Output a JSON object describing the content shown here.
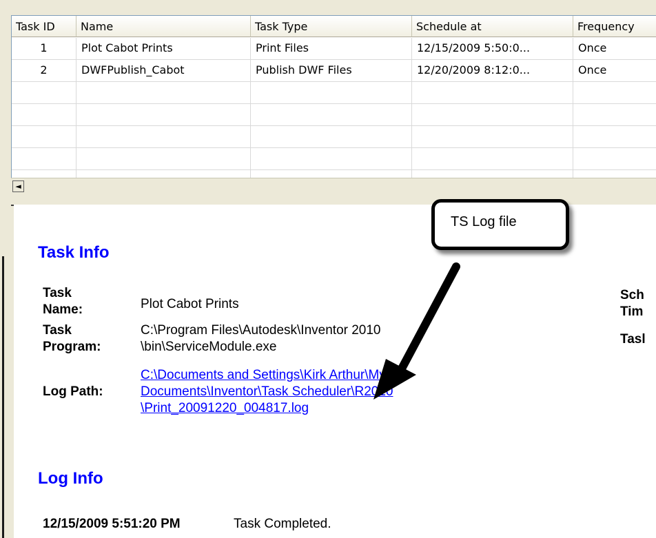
{
  "grid": {
    "columns": [
      "Task ID",
      "Name",
      "Task Type",
      "Schedule at",
      "Frequency"
    ],
    "rows": [
      [
        "1",
        "Plot Cabot Prints",
        "Print Files",
        "12/15/2009 5:50:0...",
        "Once"
      ],
      [
        "2",
        "DWFPublish_Cabot",
        "Publish DWF Files",
        "12/20/2009 8:12:0...",
        "Once"
      ]
    ],
    "scroll_left": "◄"
  },
  "callout": {
    "text": "TS Log file"
  },
  "task_info": {
    "title": "Task Info",
    "task_name_label_1": "Task",
    "task_name_label_2": "Name:",
    "task_name_value": "Plot Cabot Prints",
    "task_program_label_1": "Task",
    "task_program_label_2": "Program:",
    "task_program_value_1": "C:\\Program Files\\Autodesk\\Inventor 2010",
    "task_program_value_2": "\\bin\\ServiceModule.exe",
    "log_path_label": "Log Path:",
    "log_path_line_1": "C:\\Documents and Settings\\Kirk Arthur\\My",
    "log_path_line_2": "Documents\\Inventor\\Task Scheduler\\R2010",
    "log_path_line_3": "\\Print_20091220_004817.log",
    "sch_label_1": "Sch",
    "sch_label_2": "Tim",
    "task_label_right": "Tasl"
  },
  "log_info": {
    "title": "Log Info",
    "entry_time": "12/15/2009 5:51:20 PM",
    "entry_text": "Task Completed."
  },
  "colors": {
    "link": "#0000ff",
    "header_bg": "#ece9d8"
  },
  "icons": {
    "scroll_left": "triangle-left-icon",
    "callout_arrow": "arrow-icon"
  }
}
